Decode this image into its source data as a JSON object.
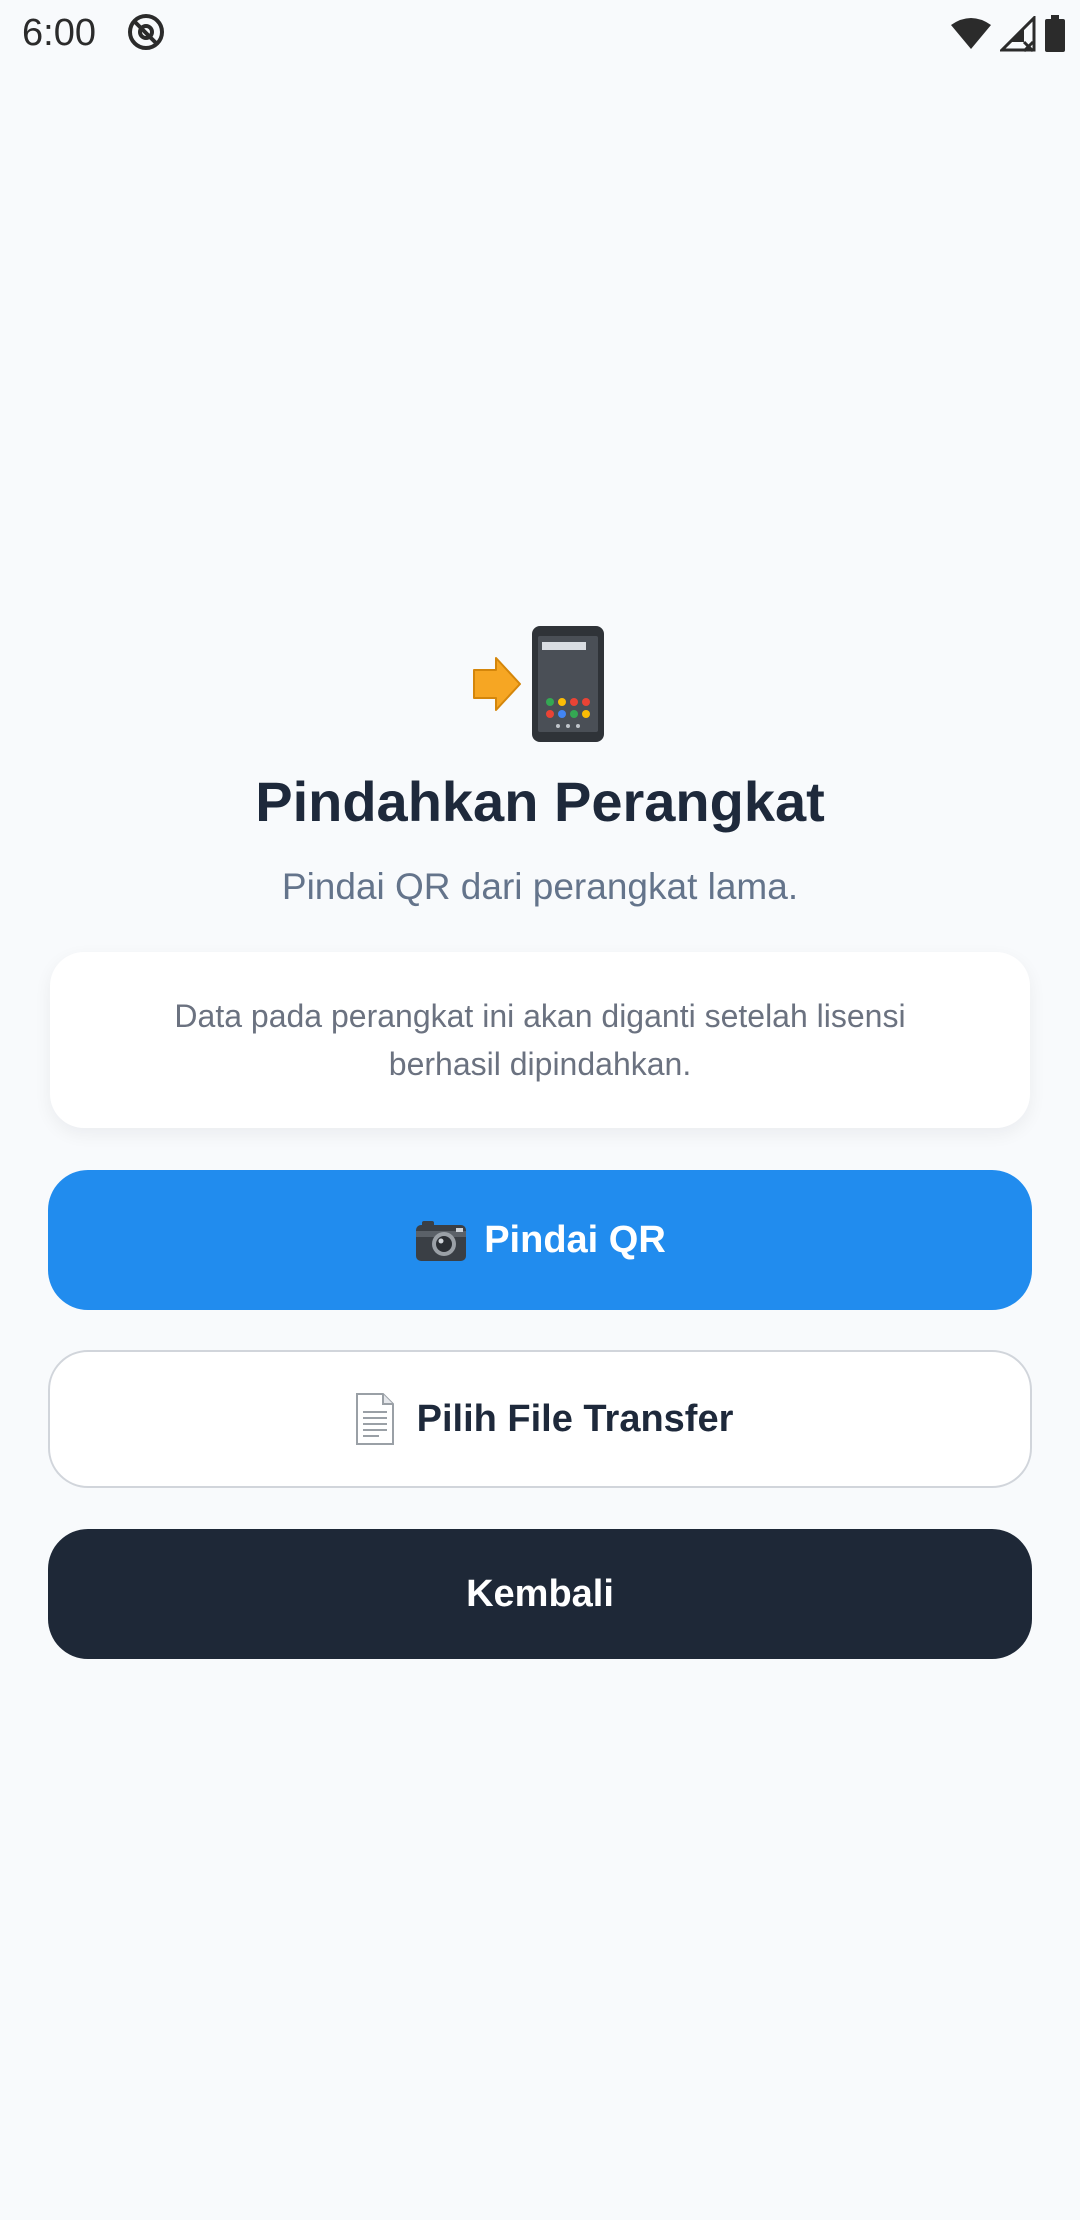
{
  "status_bar": {
    "time": "6:00",
    "icons": [
      "at-sign-icon",
      "wifi-icon",
      "signal-icon",
      "battery-icon"
    ]
  },
  "hero": {
    "icon": "phone-transfer-icon",
    "title": "Pindahkan Perangkat",
    "subtitle": "Pindai QR dari perangkat lama."
  },
  "info_card": {
    "text": "Data pada perangkat ini akan diganti setelah lisensi berhasil dipindahkan."
  },
  "buttons": {
    "scan_label": "Pindai QR",
    "scan_icon": "camera-icon",
    "file_label": "Pilih File Transfer",
    "file_icon": "document-icon",
    "back_label": "Kembali"
  },
  "colors": {
    "background": "#f8fafc",
    "primary": "#218cee",
    "dark": "#1e2837",
    "title": "#1e293b",
    "muted": "#64748b"
  }
}
